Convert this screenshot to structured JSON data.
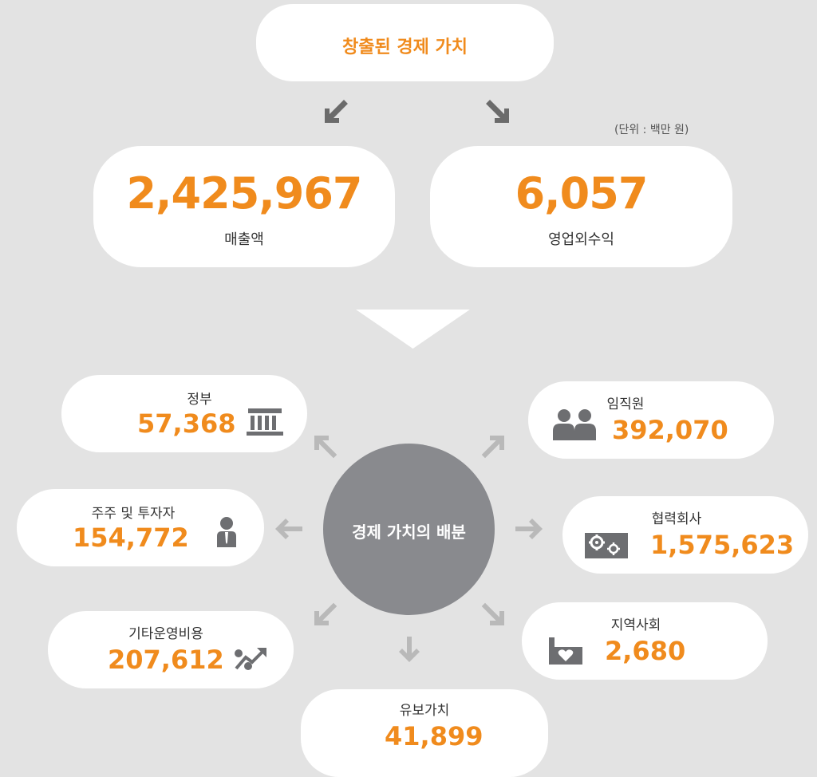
{
  "title": "창출된 경제 가치",
  "unit": "(단위 : 백만 원)",
  "created": {
    "revenue": {
      "value": "2,425,967",
      "label": "매출액"
    },
    "non_operating_income": {
      "value": "6,057",
      "label": "영업외수익"
    }
  },
  "center_label": "경제 가치의 배분",
  "distribution": {
    "government": {
      "label": "정부",
      "value": "57,368",
      "icon": "government-building-icon"
    },
    "shareholders": {
      "label": "주주 및 투자자",
      "value": "154,772",
      "icon": "investor-person-icon"
    },
    "operating_costs": {
      "label": "기타운영비용",
      "value": "207,612",
      "icon": "percent-trend-icon"
    },
    "retained": {
      "label": "유보가치",
      "value": "41,899"
    },
    "employees": {
      "label": "임직원",
      "value": "392,070",
      "icon": "people-icon"
    },
    "partners": {
      "label": "협력회사",
      "value": "1,575,623",
      "icon": "gears-icon"
    },
    "community": {
      "label": "지역사회",
      "value": "2,680",
      "icon": "community-heart-icon"
    }
  },
  "colors": {
    "accent": "#f08b1d",
    "center": "#898a8e",
    "arrow": "#b9b9b9",
    "dark_arrow": "#6b6b6b",
    "background": "#e3e3e3"
  }
}
